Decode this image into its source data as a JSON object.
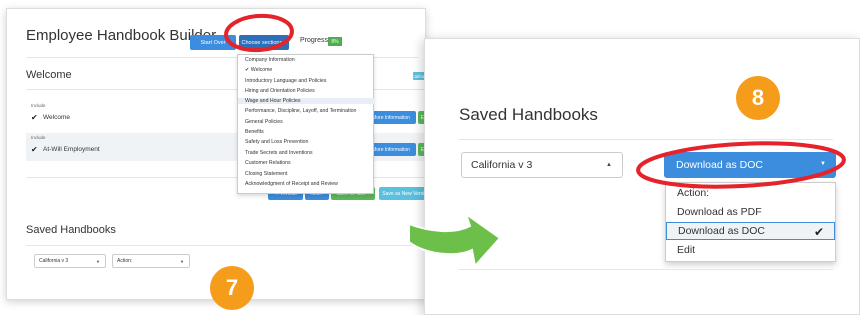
{
  "left": {
    "title": "Employee Handbook Builder",
    "start_over": "Start Over",
    "choose_sections": "Choose sections ▾",
    "progress_label": "Progress:",
    "progress_value": "8%",
    "welcome_heading": "Welcome",
    "california_tag": "California",
    "rows": [
      {
        "include": "Include",
        "check": "✔",
        "label": "Welcome",
        "more": "More Information",
        "edit": "Edit"
      },
      {
        "include": "Include",
        "check": "✔",
        "label": "At-Will Employment",
        "more": "More Information",
        "edit": "Edit"
      }
    ],
    "nav": {
      "prev": "‹ Previous",
      "next": "Next ›",
      "save_later": "Save for later ›",
      "save_as_new": "Save as New Version"
    },
    "saved_heading": "Saved Handbooks",
    "saved_select": "California v 3",
    "action_select": "Action:",
    "sections_dropdown": [
      "Company Information",
      "✔ Welcome",
      "Introductory Language and Policies",
      "Hiring and Orientation Policies",
      "Wage and Hour Policies",
      "Performance, Discipline, Layoff, and Termination",
      "General Policies",
      "Benefits",
      "Safety and Loss Prevention",
      "Trade Secrets and Inventions",
      "Customer Relations",
      "Closing Statement",
      "Acknowledgment of Receipt and Review"
    ],
    "step_badge": "7"
  },
  "right": {
    "saved_heading": "Saved Handbooks",
    "saved_select": "California v 3",
    "download_button": "Download as DOC",
    "menu": [
      {
        "label": "Action:",
        "selected": false
      },
      {
        "label": "Download as PDF",
        "selected": false
      },
      {
        "label": "Download as DOC",
        "selected": true,
        "check": "✔"
      },
      {
        "label": "Edit",
        "selected": false
      }
    ],
    "step_badge": "8"
  },
  "colors": {
    "badge": "#f59c1a",
    "highlight": "#e4232a",
    "arrow": "#6cc04a",
    "primary": "#3c8dde"
  }
}
